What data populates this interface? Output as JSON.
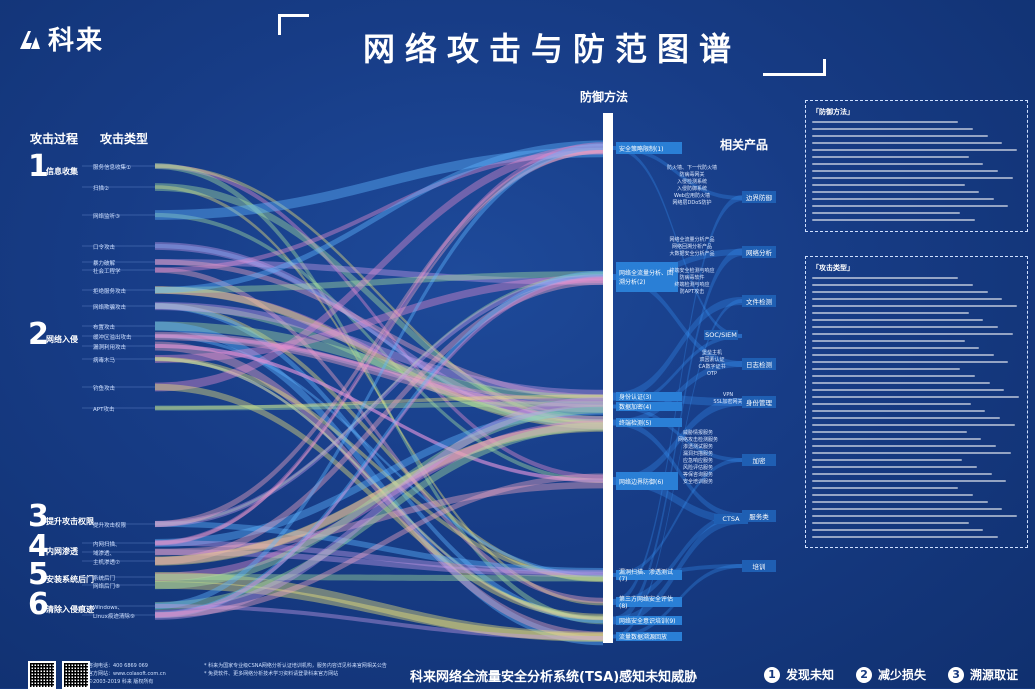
{
  "brand": {
    "name": "科来"
  },
  "title": "网络攻击与防范图谱",
  "headers": {
    "process": "攻击过程",
    "types": "攻击类型",
    "defense": "防御方法",
    "products": "相关产品"
  },
  "stages": [
    {
      "num": "1",
      "name": "信息收集",
      "types": [
        "服务信息收集①",
        "扫描②",
        "网络监听③"
      ]
    },
    {
      "num": "2",
      "name": "网络入侵",
      "types": [
        "口令攻击",
        "暴力破解",
        "社会工程学",
        "拒绝服务攻击",
        "网络欺骗攻击",
        "布置攻击",
        "缓冲区溢出攻击",
        "漏洞利用攻击",
        "病毒木马",
        "钓鱼攻击",
        "APT攻击"
      ]
    },
    {
      "num": "3",
      "name": "提升攻击权限",
      "types": [
        "提升攻击权限"
      ]
    },
    {
      "num": "4",
      "name": "内网渗透",
      "types": [
        "内网扫描、",
        "域渗透、",
        "主机渗透⑦"
      ]
    },
    {
      "num": "5",
      "name": "安装系统后门",
      "types": [
        "系统后门",
        "网络后门⑧"
      ]
    },
    {
      "num": "6",
      "name": "清除入侵痕迹",
      "types": [
        "Windows、",
        "Linux痕迹清除⑨"
      ]
    }
  ],
  "defenses": [
    {
      "label": "安全策略限制(1)",
      "subs": []
    },
    {
      "label": "网络全流量分析、回溯分析(2)",
      "subs": [
        "防火墙、下一代防火墙",
        "防病毒网关",
        "入侵检测系统",
        "入侵防御系统",
        "Web应用防火墙",
        "网络层DDoS防护",
        "网络全流量分析产品",
        "网络回溯分析产品",
        "大数据安全分析产品",
        "终端安全检测与响应",
        "防病毒软件",
        "终端检测与响应",
        "防APT攻击"
      ]
    },
    {
      "label": "身份认证(3)",
      "subs": [
        "堡垒主机",
        "双因素认证",
        "CA数字证书",
        "OTP"
      ]
    },
    {
      "label": "数据加密(4)",
      "subs": [
        "VPN",
        "SSL加密网关"
      ]
    },
    {
      "label": "终端检测(5)",
      "subs": []
    },
    {
      "label": "网络边界防御(6)",
      "subs": [
        "威胁情报服务",
        "网络攻击检测服务",
        "渗透测试服务",
        "漏洞扫描服务",
        "应急响应服务",
        "风险评估服务",
        "等保咨询服务",
        "安全培训服务"
      ]
    },
    {
      "label": "漏洞扫描、渗透测试(7)",
      "subs": []
    },
    {
      "label": "第三方网络安全评估(8)",
      "subs": []
    },
    {
      "label": "网络安全意识培训(9)",
      "subs": []
    },
    {
      "label": "流量数据溯源回放",
      "subs": []
    }
  ],
  "products": [
    "边界防御",
    "网络分析",
    "文件检测",
    "SOC/SIEM",
    "日志检测",
    "身份管理",
    "加密",
    "服务类",
    "CTSA",
    "培训"
  ],
  "right_boxes": [
    {
      "title": "「防御方法」"
    },
    {
      "title": "「攻击类型」"
    }
  ],
  "footer": {
    "hotline": "咨询电话：400 6869 069",
    "site": "官方网站：www.colasoft.com.cn",
    "copyright": "©2003-2019 科来 版权所有",
    "note1": "* 科来为国家专业级CSNA网络分析认证培训机构，服务内容详见科来官网相关公告",
    "note2": "* 免费软件、更多网络分析技术学习资料请登录科来官方网站"
  },
  "tagline": "科来网络全流量安全分析系统(TSA)感知未知威胁",
  "pills": [
    {
      "num": "1",
      "label": "发现未知"
    },
    {
      "num": "2",
      "label": "减少损失"
    },
    {
      "num": "3",
      "label": "溯源取证"
    }
  ],
  "colors": {
    "background": "#16387f",
    "defense_block": "#2a7fd6",
    "flow_pink": "#e58ccf",
    "flow_yellow": "#f1e57a",
    "flow_green": "#a8e0a0",
    "flow_blue": "#5fb6ff"
  }
}
